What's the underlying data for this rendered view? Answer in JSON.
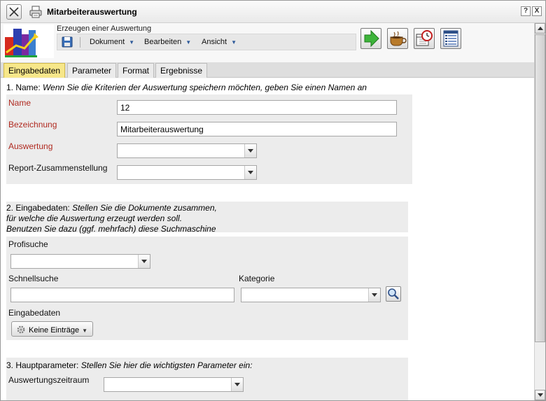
{
  "window": {
    "title": "Mitarbeiterauswertung",
    "help_label": "?",
    "close_label": "X"
  },
  "header": {
    "subtitle": "Erzeugen einer Auswertung",
    "menu": [
      {
        "label": "Dokument"
      },
      {
        "label": "Bearbeiten"
      },
      {
        "label": "Ansicht"
      }
    ],
    "tool_buttons": [
      "forward-arrow-icon",
      "coffee-cup-icon",
      "calendar-clock-icon",
      "list-view-icon"
    ]
  },
  "tabs": [
    {
      "label": "Eingabedaten",
      "active": true
    },
    {
      "label": "Parameter",
      "active": false
    },
    {
      "label": "Format",
      "active": false
    },
    {
      "label": "Ergebnisse",
      "active": false
    }
  ],
  "section1": {
    "prefix": "1. Name: ",
    "hint": "Wenn Sie die Kriterien der Auswertung speichern möchten, geben Sie einen Namen an",
    "name_label": "Name",
    "name_value": "12",
    "bezeichnung_label": "Bezeichnung",
    "bezeichnung_value": "Mitarbeiterauswertung",
    "auswertung_label": "Auswertung",
    "report_label": "Report-Zusammenstellung"
  },
  "section2": {
    "prefix": "2. Eingabedaten: ",
    "hint_line1": "Stellen Sie die Dokumente zusammen,",
    "hint_line2": "für welche die Auswertung erzeugt werden soll.",
    "hint_line3": "Benutzen Sie dazu (ggf. mehrfach) diese Suchmaschine",
    "profisuche_label": "Profisuche",
    "schnellsuche_label": "Schnellsuche",
    "kategorie_label": "Kategorie",
    "eingabedaten_label": "Eingabedaten",
    "keine_eintraege": "Keine Einträge"
  },
  "section3": {
    "prefix": "3. Hauptparameter: ",
    "hint": "Stellen Sie hier die wichtigsten Parameter ein:",
    "zeitraum_label": "Auswertungszeitraum"
  },
  "colors": {
    "active_tab": "#f7e78a",
    "required_label": "#b02a20",
    "panel_bg": "#ececec"
  }
}
